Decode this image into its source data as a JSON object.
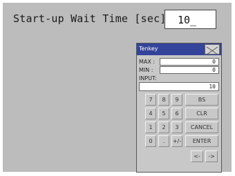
{
  "setting": {
    "label": "Start-up Wait Time [sec]",
    "value": "10_"
  },
  "tenkey": {
    "title": "Tenkey",
    "close_icon": "close-x-icon",
    "max_label": "MAX :",
    "max_value": "0",
    "min_label": "MIN :",
    "min_value": "0",
    "input_label": "INPUT:",
    "input_value": "10",
    "keys": {
      "k7": "7",
      "k8": "8",
      "k9": "9",
      "bs": "BS",
      "k4": "4",
      "k5": "5",
      "k6": "6",
      "clr": "CLR",
      "k1": "1",
      "k2": "2",
      "k3": "3",
      "cancel": "CANCEL",
      "k0": "0",
      "dot": ".",
      "plusminus": "+/-",
      "enter": "ENTER",
      "left": "<-",
      "right": "->"
    }
  }
}
